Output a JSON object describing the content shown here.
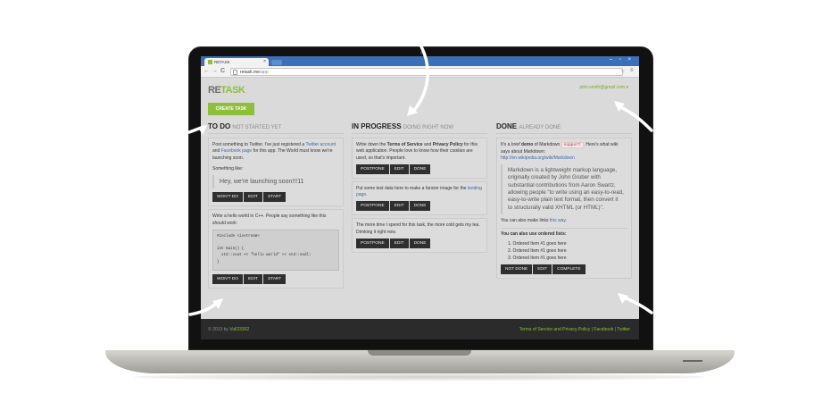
{
  "browser": {
    "tab_title": "RETASK",
    "tab_close": "×",
    "window_controls": "‒ ▫ ×",
    "nav": {
      "back": "←",
      "forward": "→",
      "reload": "C"
    },
    "url_host": "retask.me",
    "url_path": "/app",
    "star": "☆",
    "menu": "≡"
  },
  "app": {
    "logo_re": "RE",
    "logo_task": "TASK",
    "user_email": "john.smith@gmail.com ▾",
    "create_button": "CREATE TASK"
  },
  "columns": {
    "todo": {
      "title": "TO DO",
      "subtitle": "NOT STARTED YET",
      "card1": {
        "text_before_twitter": "Post something to Twitter. I've just registered a ",
        "twitter_link": "Twitter account",
        "text_and": " and ",
        "facebook_link": "Facebook page",
        "text_after": " for this app. The World must know we're launching soon.",
        "something_like": "Something like:",
        "quote": "Hey, we're launching soon!!!11"
      },
      "card2": {
        "text": "Write a hello world in C++. People say something like this should work:",
        "code": "#include <iostream>\n\nint main() {\n  std::cout << \"hello world\" << std::endl;\n}"
      },
      "buttons": {
        "wont_do": "WON'T DO",
        "edit": "EDIT",
        "start": "START"
      }
    },
    "in_progress": {
      "title": "IN PROGRESS",
      "subtitle": "DOING RIGHT NOW",
      "card1": {
        "text1": "Write down the ",
        "tos": "Terms of Service",
        "and": " and ",
        "privacy": "Privacy Policy",
        "text2": " for this web application. People love to know how their ",
        "cookies": "cookies",
        "text3": " are used, so that's important."
      },
      "card2": {
        "text": "Put some test data here to make a fancier image for the ",
        "link": "landing page",
        "end": "."
      },
      "card3": {
        "text": "The more time I spend for this task, the more cold gets my tea. Drinking it right now."
      },
      "buttons": {
        "postpone": "POSTPONE",
        "edit": "EDIT",
        "done": "DONE"
      }
    },
    "done": {
      "title": "DONE",
      "subtitle": "ALREADY DONE",
      "card1": {
        "t1": "It's a ",
        "brief": "brief",
        "demo": "demo",
        "t2": " of Markdown ",
        "tag": "support",
        "t3": ". Here's what wiki says about Markdown:",
        "wiki_link": "http://en.wikipedia.org/wiki/Markdown",
        "quote": "Markdown is a lightweight markup language, originally created by John Gruber with substantial contributions from Aaron Swartz, allowing people \"to write using an easy-to-read, easy-to-write plain text format, then convert it to structurally valid XHTML (or HTML)\".",
        "links_text": "You can also make links ",
        "links_link": "this way",
        "links_end": ".",
        "ordered_heading": "You can also use ordered lists:",
        "items": [
          "1.  Ordered Item #1 goes here",
          "2.  Ordered Item #1 goes here",
          "3.  Ordered Item #1 goes here"
        ]
      },
      "buttons": {
        "not_done": "NOT DONE",
        "edit": "EDIT",
        "complete": "COMPLETE"
      }
    }
  },
  "footer": {
    "left_prefix": "© 2013 by ",
    "left_author": "Voll23302",
    "right": "Terms of Service and Privacy Policy | Facebook | Twitter"
  },
  "colors": {
    "accent": "#8dbf3a",
    "link": "#3a6aa8",
    "browser_chrome": "#3c6fb6",
    "footer": "#2b2b2b"
  }
}
